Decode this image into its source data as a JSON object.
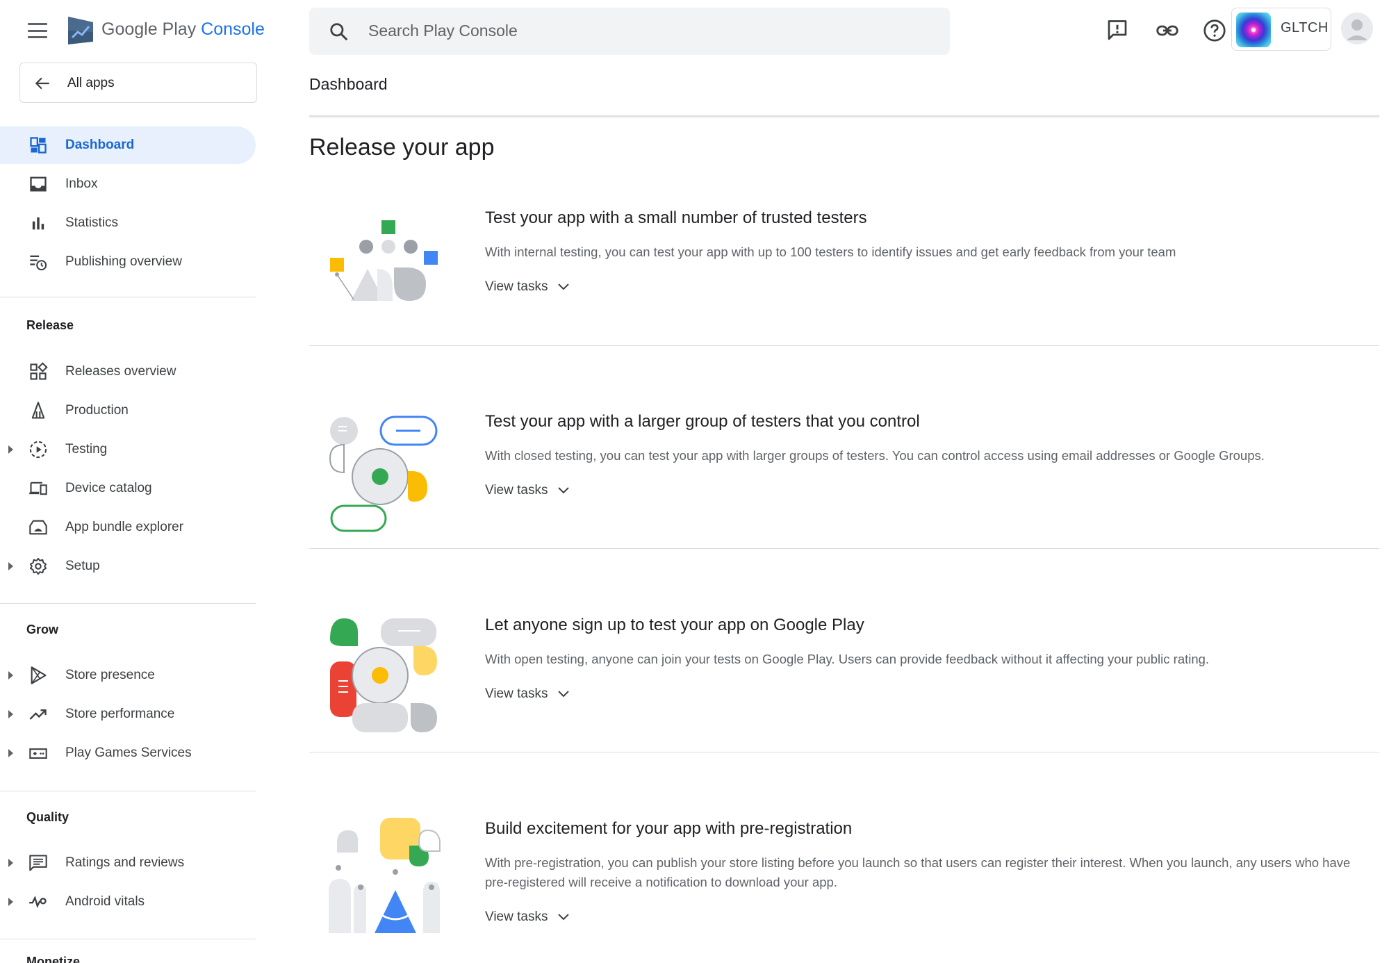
{
  "header": {
    "logo_prefix": "Google Play",
    "logo_suffix": "Console",
    "search_placeholder": "Search Play Console",
    "account_name": "GLTCH"
  },
  "sidebar": {
    "all_apps": "All apps",
    "top_items": [
      {
        "label": "Dashboard",
        "icon": "dashboard-icon",
        "active": true
      },
      {
        "label": "Inbox",
        "icon": "inbox-icon"
      },
      {
        "label": "Statistics",
        "icon": "bar-chart-icon"
      },
      {
        "label": "Publishing overview",
        "icon": "publishing-overview-icon"
      }
    ],
    "release": {
      "title": "Release",
      "items": [
        {
          "label": "Releases overview",
          "icon": "releases-overview-icon"
        },
        {
          "label": "Production",
          "icon": "production-icon"
        },
        {
          "label": "Testing",
          "icon": "testing-icon",
          "expandable": true
        },
        {
          "label": "Device catalog",
          "icon": "device-catalog-icon"
        },
        {
          "label": "App bundle explorer",
          "icon": "app-bundle-icon"
        },
        {
          "label": "Setup",
          "icon": "gear-icon",
          "expandable": true
        }
      ]
    },
    "grow": {
      "title": "Grow",
      "items": [
        {
          "label": "Store presence",
          "icon": "play-icon",
          "expandable": true
        },
        {
          "label": "Store performance",
          "icon": "trending-up-icon",
          "expandable": true
        },
        {
          "label": "Play Games Services",
          "icon": "gamepad-icon",
          "expandable": true
        }
      ]
    },
    "quality": {
      "title": "Quality",
      "items": [
        {
          "label": "Ratings and reviews",
          "icon": "reviews-icon",
          "expandable": true
        },
        {
          "label": "Android vitals",
          "icon": "vitals-icon",
          "expandable": true
        }
      ]
    },
    "monetize": {
      "title": "Monetize"
    }
  },
  "main": {
    "page_title": "Dashboard",
    "heading": "Release your app",
    "cards": [
      {
        "title": "Test your app with a small number of trusted testers",
        "description": "With internal testing, you can test your app with up to 100 testers to identify issues and get early feedback from your team",
        "action": "View tasks"
      },
      {
        "title": "Test your app with a larger group of testers that you control",
        "description": "With closed testing, you can test your app with larger groups of testers. You can control access using email addresses or Google Groups.",
        "action": "View tasks"
      },
      {
        "title": "Let anyone sign up to test your app on Google Play",
        "description": "With open testing, anyone can join your tests on Google Play. Users can provide feedback without it affecting your public rating.",
        "action": "View tasks"
      },
      {
        "title": "Build excitement for your app with pre-registration",
        "description": "With pre-registration, you can publish your store listing before you launch so that users can register their interest. When you launch, any users who have pre-registered will receive a notification to download your app.",
        "action": "View tasks"
      }
    ]
  },
  "colors": {
    "accent": "#1a73e8",
    "active_bg": "#e8f0fe",
    "green": "#34a853",
    "yellow": "#fbbc04",
    "red": "#ea4335",
    "grey": "#bdc1c6"
  }
}
